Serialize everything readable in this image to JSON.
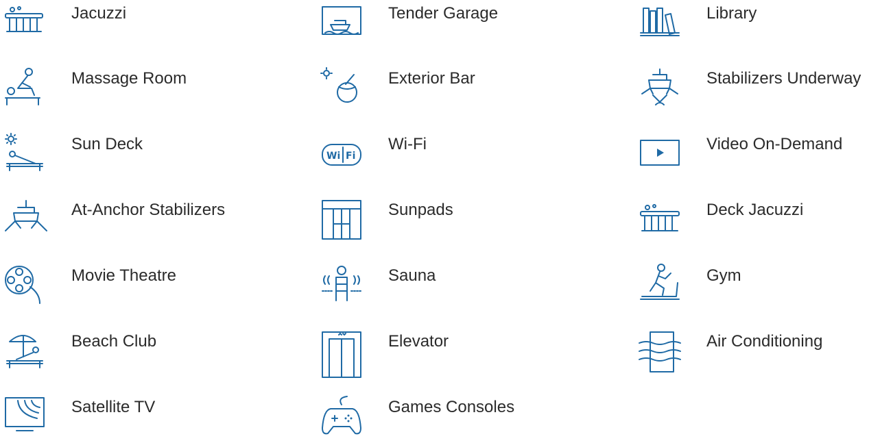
{
  "amenities": [
    {
      "label": "Jacuzzi",
      "icon": "jacuzzi-icon"
    },
    {
      "label": "Tender Garage",
      "icon": "tender-garage-icon"
    },
    {
      "label": "Library",
      "icon": "library-icon"
    },
    {
      "label": "Massage Room",
      "icon": "massage-room-icon"
    },
    {
      "label": "Exterior Bar",
      "icon": "exterior-bar-icon"
    },
    {
      "label": "Stabilizers Underway",
      "icon": "stabilizers-underway-icon"
    },
    {
      "label": "Sun Deck",
      "icon": "sun-deck-icon"
    },
    {
      "label": "Wi-Fi",
      "icon": "wifi-icon"
    },
    {
      "label": "Video On-Demand",
      "icon": "video-on-demand-icon"
    },
    {
      "label": "At-Anchor Stabilizers",
      "icon": "at-anchor-stabilizers-icon"
    },
    {
      "label": "Sunpads",
      "icon": "sunpads-icon"
    },
    {
      "label": "Deck Jacuzzi",
      "icon": "deck-jacuzzi-icon"
    },
    {
      "label": "Movie Theatre",
      "icon": "movie-theatre-icon"
    },
    {
      "label": "Sauna",
      "icon": "sauna-icon"
    },
    {
      "label": "Gym",
      "icon": "gym-icon"
    },
    {
      "label": "Beach Club",
      "icon": "beach-club-icon"
    },
    {
      "label": "Elevator",
      "icon": "elevator-icon"
    },
    {
      "label": "Air Conditioning",
      "icon": "air-conditioning-icon"
    },
    {
      "label": "Satellite TV",
      "icon": "satellite-tv-icon"
    },
    {
      "label": "Games Consoles",
      "icon": "games-consoles-icon"
    }
  ],
  "colors": {
    "icon": "#1f6aa5",
    "text": "#2b2b2b",
    "background": "#ffffff"
  }
}
